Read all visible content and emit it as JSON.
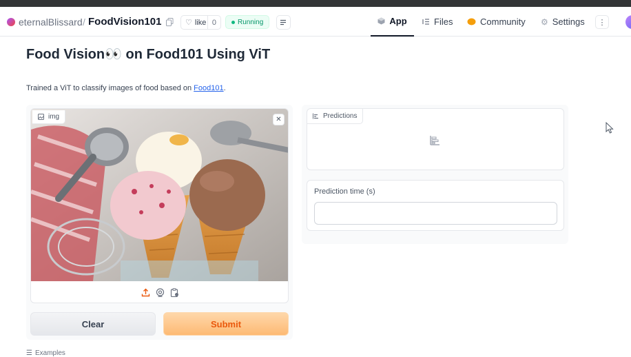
{
  "header": {
    "owner": "eternalBlissard",
    "separator": "/",
    "repo": "FoodVision101",
    "like_label": "like",
    "like_count": "0",
    "status": "Running",
    "nav": [
      {
        "label": "App",
        "icon": "app-cube-icon",
        "active": true
      },
      {
        "label": "Files",
        "icon": "files-icon",
        "active": false
      },
      {
        "label": "Community",
        "icon": "community-icon",
        "active": false
      },
      {
        "label": "Settings",
        "icon": "gear-icon",
        "active": false
      }
    ]
  },
  "main": {
    "title": "Food Vision👀 on Food101 Using ViT",
    "description_prefix": "Trained a ViT to classify images of food based on ",
    "description_link": "Food101",
    "description_suffix": "."
  },
  "image_input": {
    "label": "img"
  },
  "buttons": {
    "clear": "Clear",
    "submit": "Submit"
  },
  "outputs": {
    "predictions_label": "Predictions",
    "time_label": "Prediction time (s)",
    "time_value": ""
  },
  "examples_label": "Examples",
  "colors": {
    "accent": "#ea580c",
    "submit_bg": "#fdba74",
    "status_green": "#059669",
    "link": "#2563eb"
  }
}
